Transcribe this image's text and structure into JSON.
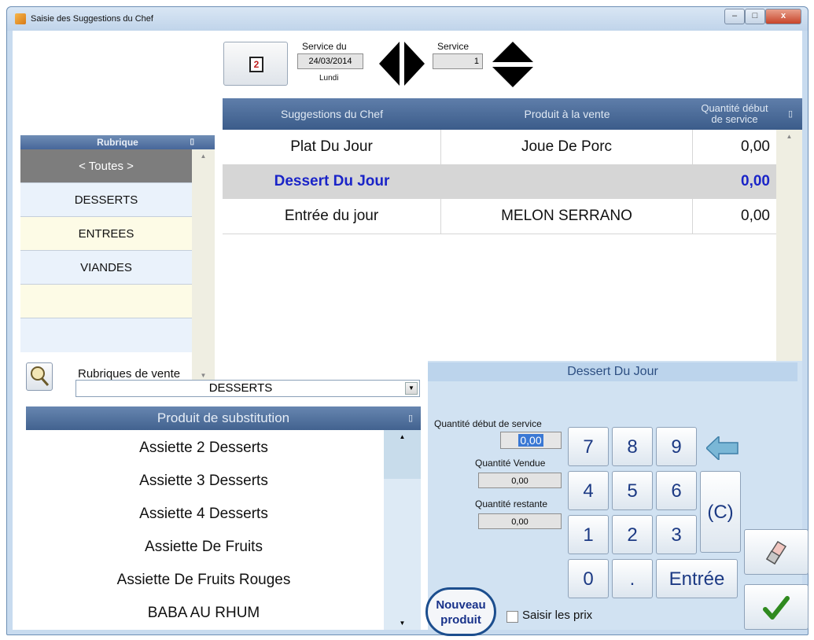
{
  "window": {
    "title": "Saisie des Suggestions du Chef",
    "min": "–",
    "max": "□",
    "close": "x"
  },
  "header": {
    "service_du_label": "Service du",
    "date": "24/03/2014",
    "day": "Lundi",
    "service_label": "Service",
    "service_number": "1"
  },
  "grid": {
    "col_suggestion": "Suggestions du Chef",
    "col_produit": "Produit à la vente",
    "col_qty_line1": "Quantité début",
    "col_qty_line2": "de service",
    "rows": [
      {
        "suggestion": "Plat Du Jour",
        "produit": "Joue De Porc",
        "qty": "0,00"
      },
      {
        "suggestion": "Dessert Du Jour",
        "produit": "",
        "qty": "0,00"
      },
      {
        "suggestion": "Entrée du jour",
        "produit": "MELON SERRANO",
        "qty": "0,00"
      }
    ]
  },
  "rubrique": {
    "header": "Rubrique",
    "items": [
      "< Toutes >",
      "DESSERTS",
      "ENTREES",
      "VIANDES"
    ]
  },
  "rubriques_vente": {
    "label": "Rubriques de vente",
    "value": "DESSERTS"
  },
  "substitution": {
    "header": "Produit de substitution",
    "items": [
      "Assiette 2 Desserts",
      "Assiette 3 Desserts",
      "Assiette 4 Desserts",
      "Assiette De Fruits",
      "Assiette De Fruits Rouges",
      "BABA AU RHUM"
    ]
  },
  "edit": {
    "title": "Dessert Du Jour",
    "qty_debut_label": "Quantité début de service",
    "qty_debut_value": "0,00",
    "qty_vendue_label": "Quantité Vendue",
    "qty_vendue_value": "0,00",
    "qty_restante_label": "Quantité restante",
    "qty_restante_value": "0,00"
  },
  "keypad": {
    "k7": "7",
    "k8": "8",
    "k9": "9",
    "k4": "4",
    "k5": "5",
    "k6": "6",
    "k1": "1",
    "k2": "2",
    "k3": "3",
    "k0": "0",
    "kdot": ".",
    "clear": "(C)",
    "enter": "Entrée"
  },
  "nouveau_line1": "Nouveau",
  "nouveau_line2": "produit",
  "saisir_prix": "Saisir les prix",
  "colors": {
    "accent": "#1a24c8",
    "header": "#4a6a98",
    "panel": "#d1e2f2"
  }
}
